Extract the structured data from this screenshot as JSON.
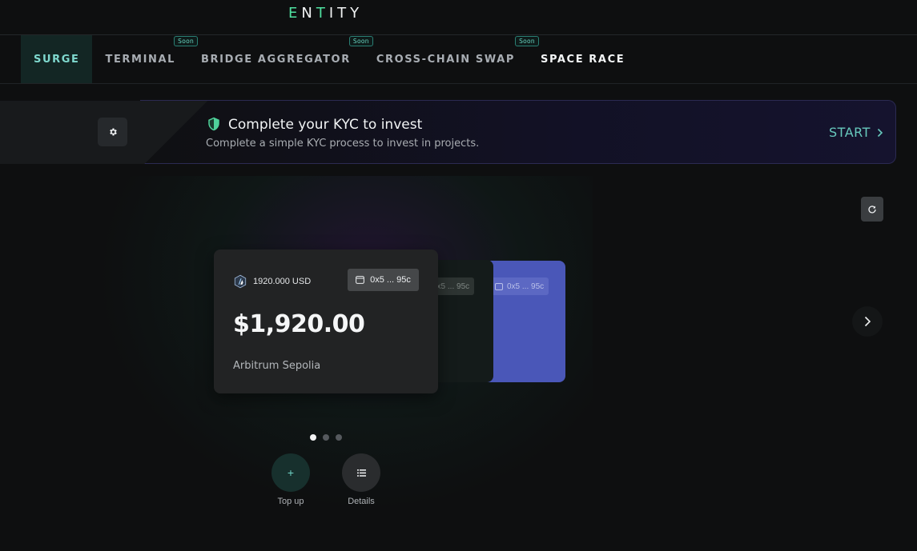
{
  "brand": {
    "logo_text": "ENTITY",
    "accent": "#4fe0a0"
  },
  "nav": {
    "items": [
      {
        "label": "SURGE",
        "active": true,
        "soon": false
      },
      {
        "label": "TERMINAL",
        "active": false,
        "soon": true
      },
      {
        "label": "BRIDGE AGGREGATOR",
        "active": false,
        "soon": true
      },
      {
        "label": "CROSS-CHAIN SWAP",
        "active": false,
        "soon": true
      },
      {
        "label": "SPACE RACE",
        "active": false,
        "soon": false
      }
    ],
    "soon_label": "Soon"
  },
  "kyc": {
    "title": "Complete your KYC to invest",
    "subtitle": "Complete a simple KYC process to invest in projects.",
    "cta": "START",
    "icon": "shield-check-icon"
  },
  "cards": [
    {
      "token_amount": "1920.000 USD",
      "address": "0x5 ... 95c",
      "balance": "$1,920.00",
      "network": "Arbitrum Sepolia",
      "icon": "arbitrum-icon"
    },
    {
      "address": "0x5 ... 95c",
      "color": "#141b1a"
    },
    {
      "address": "0x5 ... 95c",
      "color": "#4a57b8"
    }
  ],
  "carousel": {
    "pages": 3,
    "current": 1
  },
  "actions": {
    "top_up": "Top up",
    "details": "Details"
  },
  "colors": {
    "background": "#0e0f10",
    "active_tab": "#132624",
    "cta": "#67c9bd"
  }
}
